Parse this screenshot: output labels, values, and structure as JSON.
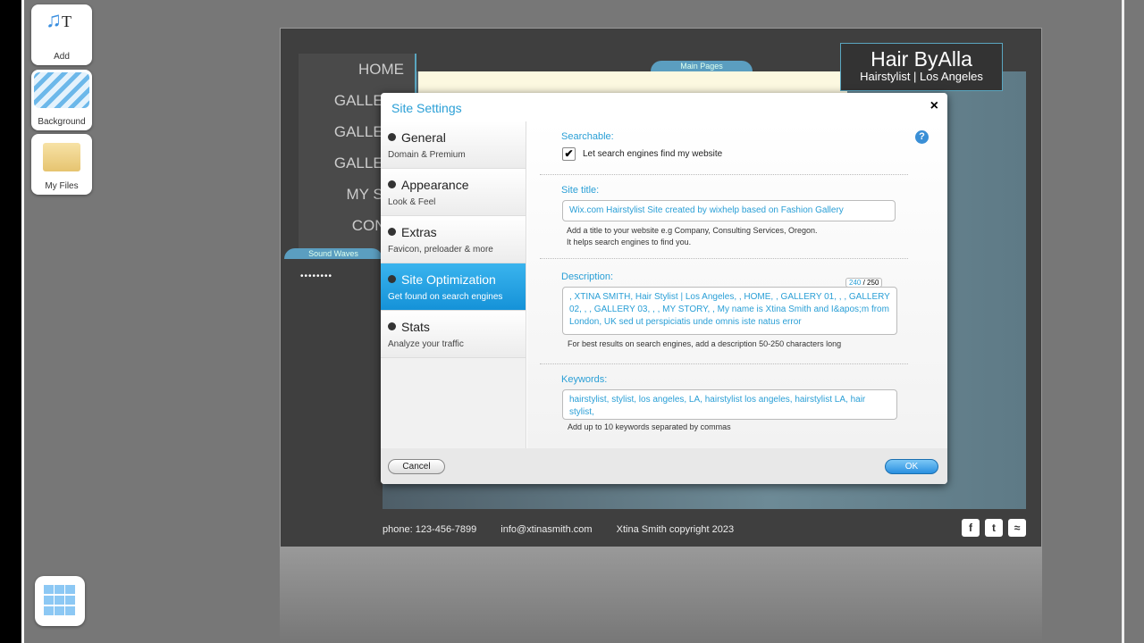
{
  "toolbar": {
    "add": "Add",
    "background": "Background",
    "files": "My Files"
  },
  "site": {
    "nav": [
      "HOME",
      "GALLERY",
      "GALLERY",
      "GALLERY",
      "MY STO",
      "CONTA"
    ],
    "main_pages_tab": "Main Pages",
    "sound_waves_tab": "Sound Waves",
    "logo_title": "Hair ByAlla",
    "logo_sub": "Hairstylist | Los Angeles",
    "footer": {
      "phone": "phone: 123-456-7899",
      "email": "info@xtinasmith.com",
      "copyright": "Xtina Smith copyright 2023"
    },
    "social": [
      "facebook-icon",
      "twitter-icon",
      "rss-icon"
    ]
  },
  "dialog": {
    "title": "Site Settings",
    "menu": [
      {
        "title": "General",
        "sub": "Domain & Premium"
      },
      {
        "title": "Appearance",
        "sub": "Look & Feel"
      },
      {
        "title": "Extras",
        "sub": "Favicon, preloader & more"
      },
      {
        "title": "Site Optimization",
        "sub": "Get found on search engines",
        "active": true
      },
      {
        "title": "Stats",
        "sub": "Analyze your traffic"
      }
    ],
    "searchable_label": "Searchable:",
    "searchable_checkbox": "Let search engines find my website",
    "searchable_checked": true,
    "site_title_label": "Site title:",
    "site_title_value": "Wix.com Hairstylist Site created by wixhelp based on Fashion Gallery",
    "site_title_hint1": "Add a title to your website e.g Company, Consulting Services, Oregon.",
    "site_title_hint2": "It helps search engines to find you.",
    "description_label": "Description:",
    "description_count": "240",
    "description_max": "/ 250",
    "description_value": ", XTINA SMITH, Hair Stylist | Los Angeles, , HOME, , GALLERY 01, , , GALLERY 02, , , GALLERY 03, , , MY STORY, , My name is Xtina Smith and I&apos;m from London, UK sed ut perspiciatis unde omnis iste natus error",
    "description_hint": "For best results on search engines, add a description 50-250 characters long",
    "keywords_label": "Keywords:",
    "keywords_value": "hairstylist, stylist, los angeles, LA, hairstylist los angeles, hairstylist LA, hair stylist,",
    "keywords_hint": "Add up to 10 keywords separated by commas",
    "cancel": "Cancel",
    "ok": "OK",
    "close": "×",
    "help": "?"
  },
  "colors": {
    "accent": "#2a9fd6",
    "active_menu": "#1592d8"
  }
}
